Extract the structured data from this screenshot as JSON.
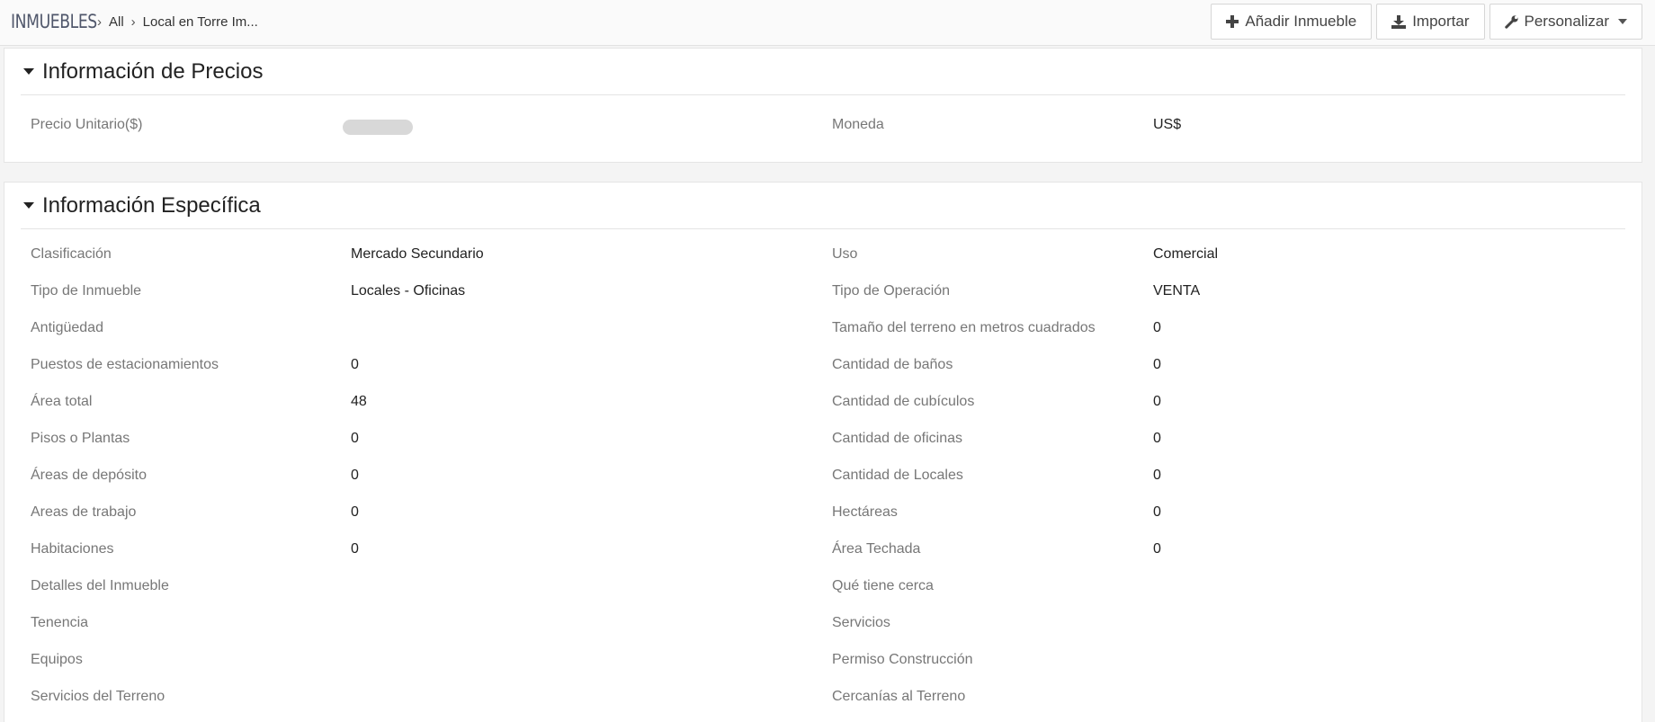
{
  "topbar": {
    "module_title": "INMUEBLES",
    "breadcrumb": [
      "All",
      "Local en Torre Im..."
    ],
    "buttons": {
      "add": "Añadir Inmueble",
      "import": "Importar",
      "customize": "Personalizar"
    }
  },
  "precios": {
    "title": "Información de Precios",
    "row": {
      "l1": "Precio Unitario($)",
      "v1_redacted": true,
      "l2": "Moneda",
      "v2": "US$"
    }
  },
  "especifica": {
    "title": "Información Específica",
    "rows": [
      {
        "l1": "Clasificación",
        "v1": "Mercado Secundario",
        "l2": "Uso",
        "v2": "Comercial"
      },
      {
        "l1": "Tipo de Inmueble",
        "v1": "Locales - Oficinas",
        "l2": "Tipo de Operación",
        "v2": "VENTA"
      },
      {
        "l1": "Antigüedad",
        "v1": "",
        "l2": "Tamaño del terreno en metros cuadrados",
        "v2": "0"
      },
      {
        "l1": "Puestos de estacionamientos",
        "v1": "0",
        "l2": "Cantidad de baños",
        "v2": "0"
      },
      {
        "l1": "Área total",
        "v1": "48",
        "l2": "Cantidad de cubículos",
        "v2": "0"
      },
      {
        "l1": "Pisos o Plantas",
        "v1": "0",
        "l2": "Cantidad de oficinas",
        "v2": "0"
      },
      {
        "l1": "Áreas de depósito",
        "v1": "0",
        "l2": "Cantidad de Locales",
        "v2": "0"
      },
      {
        "l1": "Areas de trabajo",
        "v1": "0",
        "l2": "Hectáreas",
        "v2": "0"
      },
      {
        "l1": "Habitaciones",
        "v1": "0",
        "l2": "Área Techada",
        "v2": "0"
      },
      {
        "l1": "Detalles del Inmueble",
        "v1": "",
        "l2": "Qué tiene cerca",
        "v2": ""
      },
      {
        "l1": "Tenencia",
        "v1": "",
        "l2": "Servicios",
        "v2": ""
      },
      {
        "l1": "Equipos",
        "v1": "",
        "l2": "Permiso Construcción",
        "v2": ""
      },
      {
        "l1": "Servicios del Terreno",
        "v1": "",
        "l2": "Cercanías al Terreno",
        "v2": ""
      }
    ]
  },
  "icons": {
    "add": "plus-icon",
    "import": "download-icon",
    "customize": "wrench-icon",
    "dropdown": "caret-down-icon",
    "separator": "chevron-right-icon",
    "collapse": "triangle-down-icon"
  },
  "colors": {
    "label": "#777777",
    "value": "#222222",
    "module_title": "#50576b",
    "border": "#e4e4e4"
  }
}
